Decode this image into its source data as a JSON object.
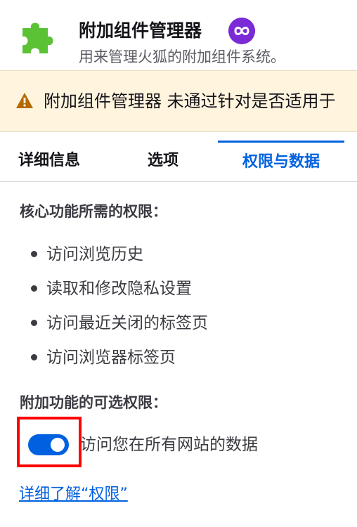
{
  "header": {
    "addon_name": "附加组件管理器",
    "description": "用来管理火狐的附加组件系统。",
    "badge_icon": "recommended-infinity-icon",
    "badge_color": "#7b2bd6",
    "addon_icon": "puzzle-icon",
    "addon_icon_color": "#5bc236"
  },
  "warning": {
    "icon": "warning-triangle-icon",
    "text": "附加组件管理器 未通过针对是否适用于"
  },
  "tabs": [
    {
      "label": "详细信息",
      "active": false
    },
    {
      "label": "选项",
      "active": false
    },
    {
      "label": "权限与数据",
      "active": true
    }
  ],
  "permissions": {
    "required_heading": "核心功能所需的权限：",
    "required_items": [
      "访问浏览历史",
      "读取和修改隐私设置",
      "访问最近关闭的标签页",
      "访问浏览器标签页"
    ],
    "optional_heading": "附加功能的可选权限：",
    "optional_items": [
      {
        "label": "访问您在所有网站的数据",
        "enabled": true
      }
    ],
    "learn_more": "详细了解“权限”"
  },
  "colors": {
    "accent": "#0061e0",
    "warning_bg": "#fff4de",
    "highlight": "#ff0000"
  }
}
